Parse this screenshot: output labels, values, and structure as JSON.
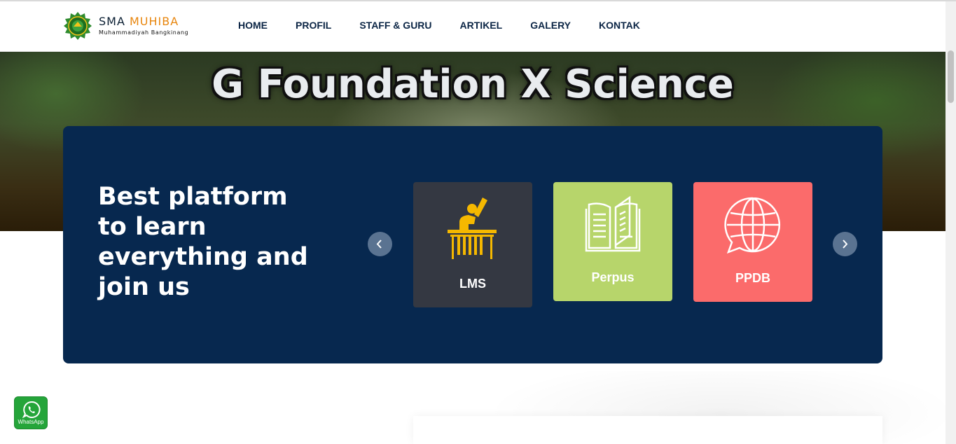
{
  "brand": {
    "name_part1": "SMA ",
    "name_part2": "MUHIBA",
    "subtitle": "Muhammadiyah Bangkinang"
  },
  "nav": [
    "HOME",
    "PROFIL",
    "STAFF & GURU",
    "ARTIKEL",
    "GALERY",
    "KONTAK"
  ],
  "hero": {
    "banner_text": "G Foundation X Science"
  },
  "feature": {
    "heading": "Best platform to learn everything and join us",
    "cards": [
      {
        "label": "LMS",
        "icon": "student-desk-icon",
        "color": "#343842",
        "icon_color": "#f5b800"
      },
      {
        "label": "Perpus",
        "icon": "open-book-icon",
        "color": "#b7d56b"
      },
      {
        "label": "PPDB",
        "icon": "globe-chat-icon",
        "color": "#fb6b6b"
      }
    ]
  },
  "whatsapp": {
    "label": "WhatsApp",
    "color": "#25a53a"
  },
  "colors": {
    "navy": "#07284f",
    "accent": "#e8860e"
  }
}
